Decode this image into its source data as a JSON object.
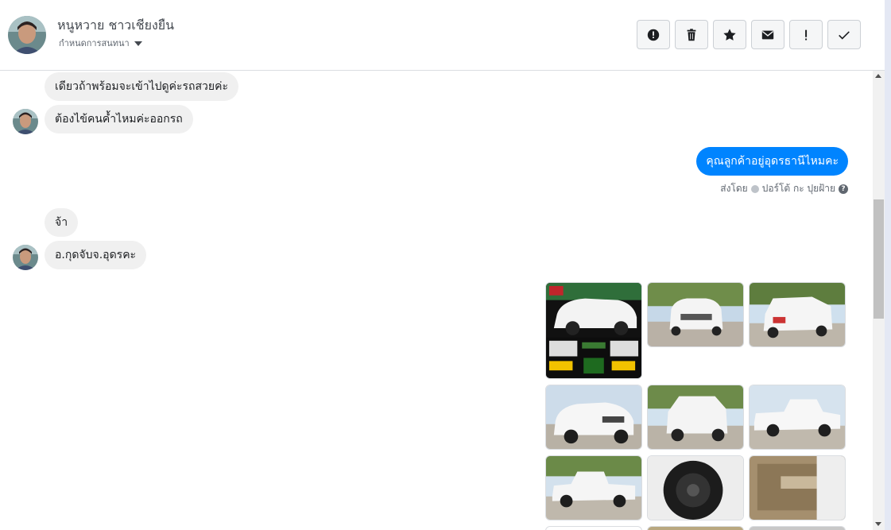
{
  "header": {
    "contact_name": "หนูหวาย ชาวเชียงยืน",
    "assign_label": "กำหนดการสนทนา"
  },
  "actions": [
    {
      "icon": "alert-circle-icon"
    },
    {
      "icon": "trash-icon"
    },
    {
      "icon": "star-icon"
    },
    {
      "icon": "envelope-icon"
    },
    {
      "icon": "exclamation-icon"
    },
    {
      "icon": "checkmark-icon"
    }
  ],
  "messages": {
    "m1": "เดียวถ้าพร้อมจะเข้าไปดูค่ะรถสวยค่ะ",
    "m2": "ต้องไข้คนค้ำไหมค่ะออกรถ",
    "m3": "คุณลูกค้าอยู่อุดรธานีไหมคะ",
    "m4": "จ้า",
    "m5": "อ.กุดจับจ.อุดรคะ"
  },
  "sent_by": {
    "prefix": "ส่งโดย",
    "name": "ปอร์โต้ กะ ปุยฝ้าย"
  },
  "photos": [
    {
      "subject": "truck-ad-collage"
    },
    {
      "subject": "white-pickup-front"
    },
    {
      "subject": "white-pickup-rear"
    },
    {
      "subject": "white-pickup-front-three-quarter"
    },
    {
      "subject": "white-pickup-rear-three-quarter"
    },
    {
      "subject": "white-pickup-side"
    },
    {
      "subject": "white-pickup-side-left"
    },
    {
      "subject": "wheel-tire-closeup"
    },
    {
      "subject": "door-interior-panel"
    }
  ],
  "colors": {
    "outgoing_bubble": "#0084ff",
    "incoming_bubble": "#f0f0f0"
  }
}
